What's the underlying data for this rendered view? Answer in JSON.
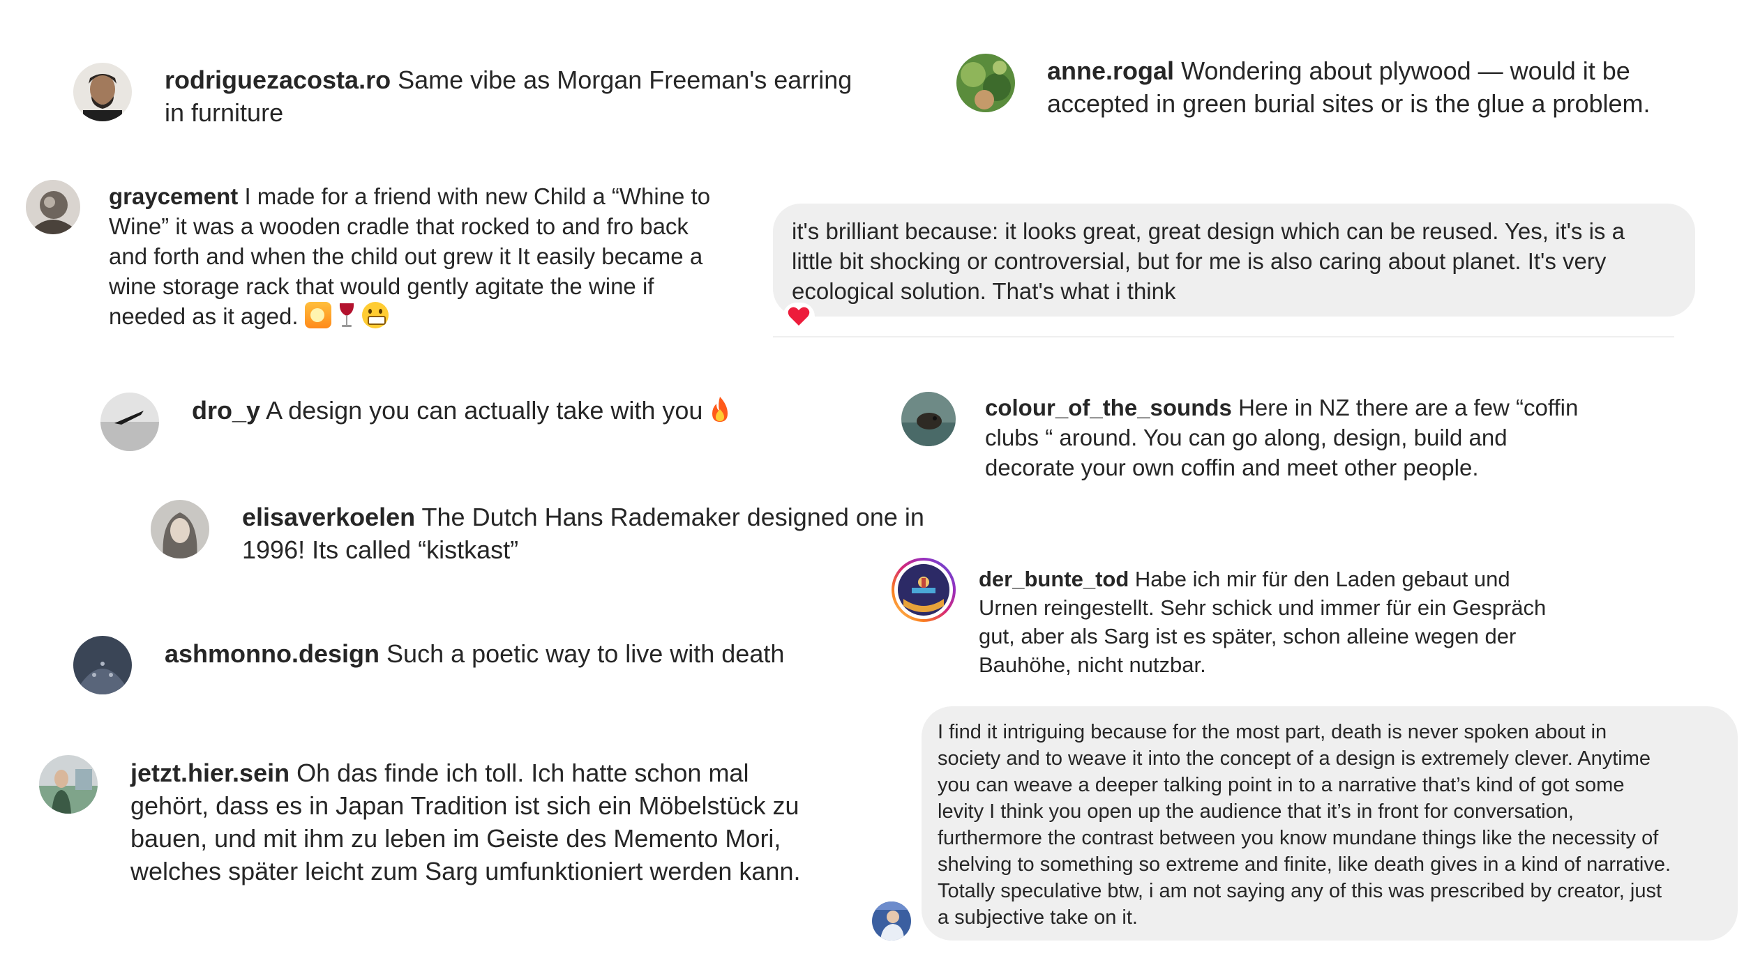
{
  "comments": [
    {
      "user": "rodriguezacosta.ro",
      "text": "Same vibe as Morgan Freeman's earring",
      "text2": "in furniture"
    },
    {
      "user": "anne.rogal",
      "text": "Wondering about plywood — would it be",
      "text2": "accepted in green burial sites or is the glue a problem."
    },
    {
      "user": "graycement",
      "lines": [
        "I made for a friend with new Child a “Whine to",
        "Wine” it was a wooden cradle that rocked to and fro back",
        "and forth and when the child out grew it It easily became a",
        "wine storage rack that would gently agitate the wine if",
        "needed as it aged."
      ]
    },
    {
      "user": "",
      "lines": [
        "it's brilliant because: it looks great, great design which can be reused. Yes, it's is a",
        "little bit shocking or controversial, but for me is also caring about planet. It's very",
        "ecological solution. That's what i think"
      ],
      "reaction": "heart"
    },
    {
      "user": "dro_y",
      "text": "A design you can actually take with you"
    },
    {
      "user": "colour_of_the_sounds",
      "text": "Here in NZ there are a few “coffin",
      "lines": [
        "clubs “ around. You can go along, design, build and",
        "decorate your own coffin and meet other people."
      ]
    },
    {
      "user": "elisaverkoelen",
      "text": "The Dutch Hans Rademaker designed one in",
      "text2": "1996! Its called “kistkast”"
    },
    {
      "user": "der_bunte_tod",
      "text": "Habe ich mir für den Laden gebaut und",
      "lines": [
        "Urnen reingestellt. Sehr schick und immer für ein Gespräch",
        "gut, aber als Sarg ist es später, schon alleine wegen der",
        "Bauhöhe, nicht nutzbar."
      ]
    },
    {
      "user": "ashmonno.design",
      "text": "Such a poetic way to live with death"
    },
    {
      "user": "jetzt.hier.sein",
      "text": "Oh das finde ich toll. Ich hatte schon mal",
      "lines": [
        "gehört, dass es in Japan Tradition ist sich ein Möbelstück zu",
        "bauen, und mit ihm zu leben im Geiste des Memento Mori,",
        "welches später leicht zum Sarg umfunktioniert werden kann."
      ]
    },
    {
      "user": "",
      "lines": [
        "I find it intriguing because for the most part, death is never spoken about in",
        "society and to weave it into the concept of a design is extremely clever. Anytime",
        "you can weave a deeper talking point in to a narrative that’s kind of got some",
        "levity I think you open up the audience that it’s in front for conversation,",
        "furthermore the contrast between you know mundane things like the necessity of",
        "shelving to something so extreme and finite, like death gives in a kind of narrative.",
        "Totally speculative btw, i am not saying any of this was prescribed by creator, just",
        "a subjective take on it."
      ]
    }
  ],
  "colors": {
    "bubble": "#efefef",
    "text": "#262626",
    "heart": "#ed1c3b"
  }
}
